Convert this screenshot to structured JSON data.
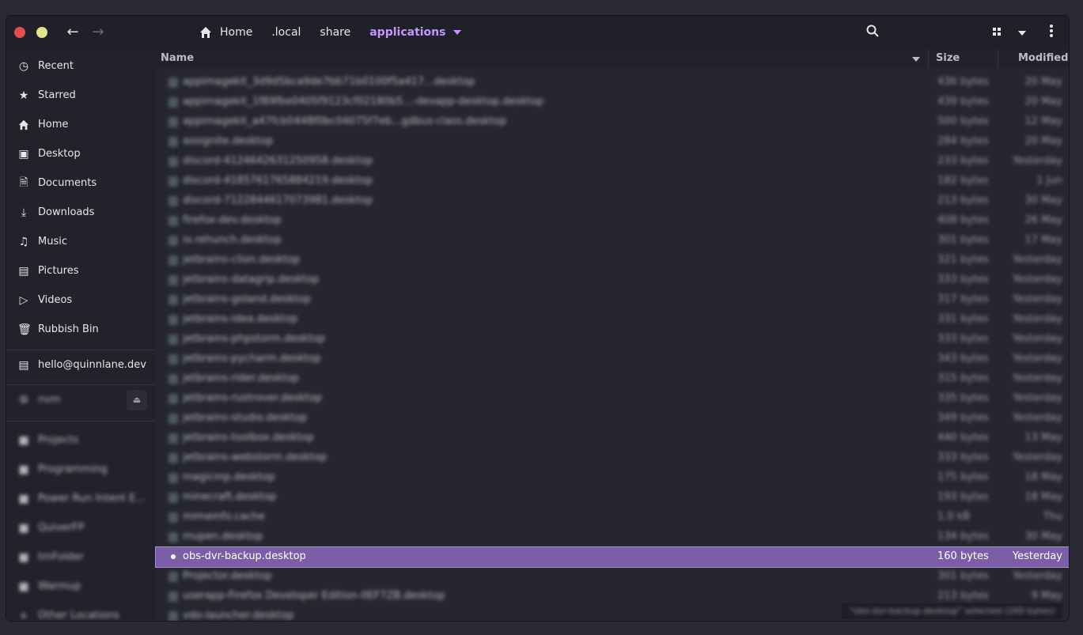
{
  "window": {
    "breadcrumbs": [
      "Home",
      ".local",
      "share",
      "applications"
    ]
  },
  "icons": {
    "back": "arrow-left-icon",
    "forward": "arrow-right-icon",
    "home": "home-icon",
    "search": "search-icon",
    "view": "grid-view-icon",
    "sort": "chevron-down-icon",
    "menu": "kebab-menu-icon"
  },
  "sidebar": {
    "places": [
      {
        "label": "Recent",
        "icon": "clock-icon"
      },
      {
        "label": "Starred",
        "icon": "star-icon"
      },
      {
        "label": "Home",
        "icon": "home-icon"
      },
      {
        "label": "Desktop",
        "icon": "desktop-icon"
      },
      {
        "label": "Documents",
        "icon": "document-icon"
      },
      {
        "label": "Downloads",
        "icon": "download-icon"
      },
      {
        "label": "Music",
        "icon": "music-icon"
      },
      {
        "label": "Pictures",
        "icon": "picture-icon"
      },
      {
        "label": "Videos",
        "icon": "video-icon"
      },
      {
        "label": "Rubbish Bin",
        "icon": "trash-icon"
      }
    ],
    "network": [
      {
        "label": "hello@quinnlane.dev",
        "icon": "server-icon"
      }
    ],
    "devices": [
      {
        "label": "nvm",
        "icon": "drive-icon"
      }
    ],
    "bookmarks": [
      {
        "label": "Projects"
      },
      {
        "label": "Programming"
      },
      {
        "label": "Power Run Intent E..."
      },
      {
        "label": "QuiverFP"
      },
      {
        "label": "tmFolder"
      },
      {
        "label": "Warmup"
      },
      {
        "label": "Other Locations"
      }
    ]
  },
  "columns": {
    "name": "Name",
    "size": "Size",
    "modified": "Modified"
  },
  "files": [
    {
      "name": "appimagekit_3d9d5bca9de7bb71b0100f5a417...desktop",
      "size": "436 bytes",
      "modified": "20 May"
    },
    {
      "name": "appimagekit_1f89fbe0405f9123cf02180b5...-devapp-desktop.desktop",
      "size": "439 bytes",
      "modified": "20 May"
    },
    {
      "name": "appimagekit_a47fcb0448f0bc04075f7eb...gdbus-class.desktop",
      "size": "500 bytes",
      "modified": "12 May"
    },
    {
      "name": "assignite.desktop",
      "size": "284 bytes",
      "modified": "20 May"
    },
    {
      "name": "discord-4124642631250958.desktop",
      "size": "233 bytes",
      "modified": "Yesterday"
    },
    {
      "name": "discord-4185761765884219.desktop",
      "size": "182 bytes",
      "modified": "1 Jun"
    },
    {
      "name": "discord-7122844617073981.desktop",
      "size": "213 bytes",
      "modified": "30 May"
    },
    {
      "name": "firefox-dev.desktop",
      "size": "408 bytes",
      "modified": "26 May"
    },
    {
      "name": "io.rehunch.desktop",
      "size": "301 bytes",
      "modified": "17 May"
    },
    {
      "name": "jetbrains-clion.desktop",
      "size": "321 bytes",
      "modified": "Yesterday"
    },
    {
      "name": "jetbrains-datagrip.desktop",
      "size": "333 bytes",
      "modified": "Yesterday"
    },
    {
      "name": "jetbrains-goland.desktop",
      "size": "317 bytes",
      "modified": "Yesterday"
    },
    {
      "name": "jetbrains-idea.desktop",
      "size": "331 bytes",
      "modified": "Yesterday"
    },
    {
      "name": "jetbrains-phpstorm.desktop",
      "size": "333 bytes",
      "modified": "Yesterday"
    },
    {
      "name": "jetbrains-pycharm.desktop",
      "size": "343 bytes",
      "modified": "Yesterday"
    },
    {
      "name": "jetbrains-rider.desktop",
      "size": "315 bytes",
      "modified": "Yesterday"
    },
    {
      "name": "jetbrains-rustrover.desktop",
      "size": "335 bytes",
      "modified": "Yesterday"
    },
    {
      "name": "jetbrains-studio.desktop",
      "size": "349 bytes",
      "modified": "Yesterday"
    },
    {
      "name": "jetbrains-toolbox.desktop",
      "size": "440 bytes",
      "modified": "13 May"
    },
    {
      "name": "jetbrains-webstorm.desktop",
      "size": "333 bytes",
      "modified": "Yesterday"
    },
    {
      "name": "magicmp.desktop",
      "size": "175 bytes",
      "modified": "18 May"
    },
    {
      "name": "minecraft.desktop",
      "size": "193 bytes",
      "modified": "18 May"
    },
    {
      "name": "mimeinfo.cache",
      "size": "1.0 kB",
      "modified": "Thu"
    },
    {
      "name": "mupen.desktop",
      "size": "134 bytes",
      "modified": "30 May"
    },
    {
      "name": "obs-dvr-backup.desktop",
      "size": "160 bytes",
      "modified": "Yesterday",
      "selected": true
    },
    {
      "name": "Projector.desktop",
      "size": "301 bytes",
      "modified": "Yesterday"
    },
    {
      "name": "userapp-Firefox Developer Edition-0EF7ZB.desktop",
      "size": "213 bytes",
      "modified": "9 May"
    },
    {
      "name": "vdo-launcher.desktop",
      "size": "",
      "modified": ""
    }
  ],
  "status": "\"obs-dvr-backup.desktop\" selected (160 bytes)"
}
